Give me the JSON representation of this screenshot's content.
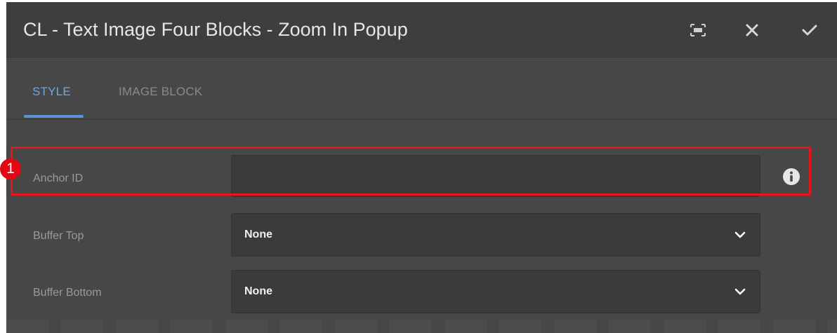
{
  "dialog": {
    "title": "CL - Text Image Four Blocks - Zoom In Popup",
    "buttons": {
      "fullscreen_icon": "fullscreen-icon",
      "close_icon": "close-icon",
      "confirm_icon": "checkmark-icon"
    }
  },
  "tabs": [
    {
      "label": "STYLE",
      "active": true
    },
    {
      "label": "IMAGE BLOCK",
      "active": false
    }
  ],
  "form": {
    "anchor_id": {
      "label": "Anchor ID",
      "value": "",
      "info_icon": "info-icon"
    },
    "buffer_top": {
      "label": "Buffer Top",
      "value": "None"
    },
    "buffer_bottom": {
      "label": "Buffer Bottom",
      "value": "None"
    }
  },
  "annotation": {
    "badge": "1",
    "color": "#e8141c"
  },
  "colors": {
    "header_bg": "#3e3e3e",
    "body_bg": "#474747",
    "field_bg": "#3b3b3b",
    "active_tab": "#6aa8e6"
  }
}
